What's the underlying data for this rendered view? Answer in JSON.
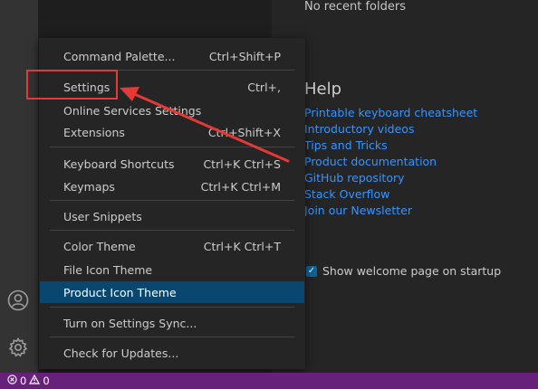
{
  "welcome": {
    "recent_text": "No recent folders",
    "help_heading": "Help",
    "help_links": [
      "Printable keyboard cheatsheet",
      "Introductory videos",
      "Tips and Tricks",
      "Product documentation",
      "GitHub repository",
      "Stack Overflow",
      "Join our Newsletter"
    ],
    "show_on_startup_label": "Show welcome page on startup",
    "show_on_startup_checked": true
  },
  "menu": {
    "items": [
      {
        "label": "Command Palette...",
        "shortcut": "Ctrl+Shift+P"
      },
      {
        "label": "Settings",
        "shortcut": "Ctrl+,"
      },
      {
        "label": "Online Services Settings",
        "shortcut": ""
      },
      {
        "label": "Extensions",
        "shortcut": "Ctrl+Shift+X"
      },
      {
        "label": "Keyboard Shortcuts",
        "shortcut": "Ctrl+K Ctrl+S"
      },
      {
        "label": "Keymaps",
        "shortcut": "Ctrl+K Ctrl+M"
      },
      {
        "label": "User Snippets",
        "shortcut": ""
      },
      {
        "label": "Color Theme",
        "shortcut": "Ctrl+K Ctrl+T"
      },
      {
        "label": "File Icon Theme",
        "shortcut": ""
      },
      {
        "label": "Product Icon Theme",
        "shortcut": ""
      },
      {
        "label": "Turn on Settings Sync...",
        "shortcut": ""
      },
      {
        "label": "Check for Updates...",
        "shortcut": ""
      }
    ],
    "selected_label": "Product Icon Theme"
  },
  "activity_bar": {
    "icons": [
      "account-icon",
      "gear-icon"
    ]
  },
  "status_bar": {
    "errors": "0",
    "warnings": "0"
  },
  "colors": {
    "accent": "#0e639c",
    "status_bar": "#68217a",
    "highlight": "#e53935",
    "link": "#3794ff"
  }
}
